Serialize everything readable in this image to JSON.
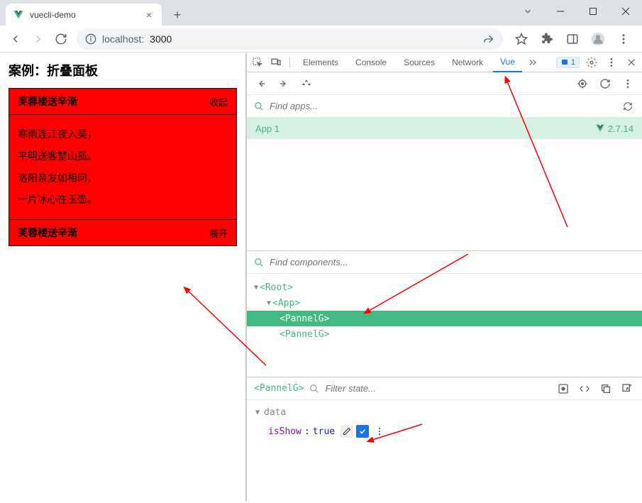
{
  "browser": {
    "tab_title": "vuecli-demo",
    "url_prefix": "localhost:",
    "url_suffix": "3000"
  },
  "page": {
    "title": "案例：折叠面板",
    "panels": [
      {
        "title": "芙蓉楼送辛渐",
        "toggle": "收起",
        "lines": [
          "寒雨连江夜入吴，",
          "平明送客楚山孤。",
          "洛阳亲友如相问，",
          "一片冰心在玉壶。"
        ]
      },
      {
        "title": "芙蓉楼送辛渐",
        "toggle": "展开"
      }
    ]
  },
  "devtools": {
    "tabs": {
      "elements": "Elements",
      "console": "Console",
      "sources": "Sources",
      "network": "Network",
      "vue": "Vue"
    },
    "badge_count": "1",
    "find_apps_placeholder": "Find apps...",
    "app_name": "App 1",
    "vue_version": "2.7.14",
    "find_components_placeholder": "Find components...",
    "tree": {
      "root": "<Root>",
      "app": "<App>",
      "panel1": "<PannelG>",
      "panel2": "<PannelG>"
    },
    "state": {
      "component": "<PannelG>",
      "filter_placeholder": "Filter state...",
      "section": "data",
      "key": "isShow",
      "value": "true"
    }
  }
}
